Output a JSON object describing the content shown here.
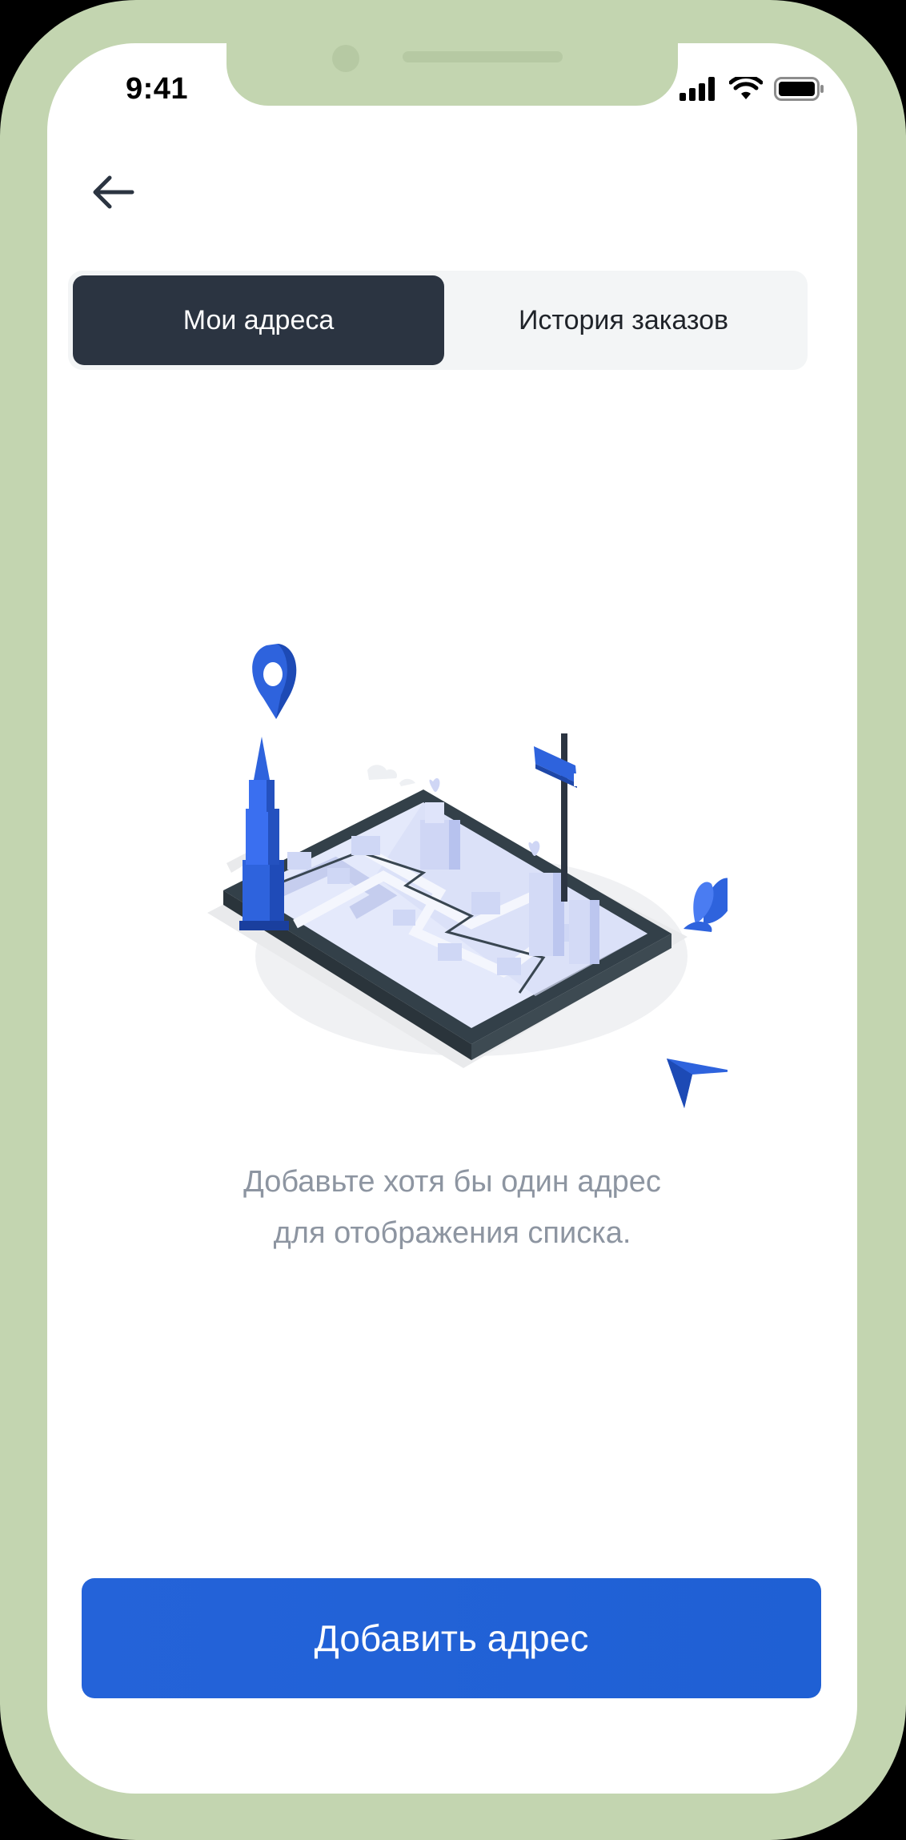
{
  "status_bar": {
    "time": "9:41"
  },
  "tabs": [
    {
      "label": "Мои адреса",
      "active": true
    },
    {
      "label": "История заказов",
      "active": false
    }
  ],
  "empty_state": {
    "line1": "Добавьте хотя бы один адрес",
    "line2": "для отображения списка."
  },
  "add_button": {
    "label": "Добавить адрес"
  },
  "icons": {
    "back": "arrow-left-icon",
    "signal": "signal-icon",
    "wifi": "wifi-icon",
    "battery": "battery-icon",
    "illustration": "city-map-illustration"
  },
  "colors": {
    "frame": "#c3d5b0",
    "active_tab": "#2b3441",
    "accent": "#1f60d4",
    "muted_text": "#8d95a1"
  }
}
